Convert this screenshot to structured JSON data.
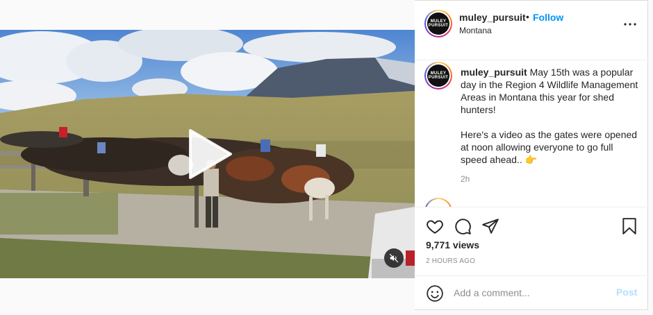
{
  "post": {
    "username": "muley_pursuit",
    "separator": "•",
    "follow_label": "Follow",
    "location": "Montana",
    "avatar_logo_line1": "MULEY",
    "avatar_logo_line2": "PURSUIT"
  },
  "caption": {
    "username": "muley_pursuit",
    "text_line1": "May 15th was a popular day in the Region 4 Wildlife Management Areas in Montana this year for shed hunters!",
    "text_line2": "Here's a video as the gates were opened at noon allowing everyone to go full speed ahead.. 👉",
    "time": "2h"
  },
  "stats": {
    "views": "9,771 views",
    "timestamp": "2 HOURS AGO"
  },
  "comment": {
    "placeholder": "Add a comment...",
    "post_label": "Post"
  },
  "colors": {
    "accent": "#0095f6",
    "post_disabled": "#b2dffc",
    "text": "#262626",
    "muted": "#8e8e8e"
  },
  "icons": [
    "play-icon",
    "mute-icon",
    "more-icon",
    "heart-icon",
    "comment-icon",
    "share-icon",
    "bookmark-icon",
    "emoji-icon"
  ]
}
